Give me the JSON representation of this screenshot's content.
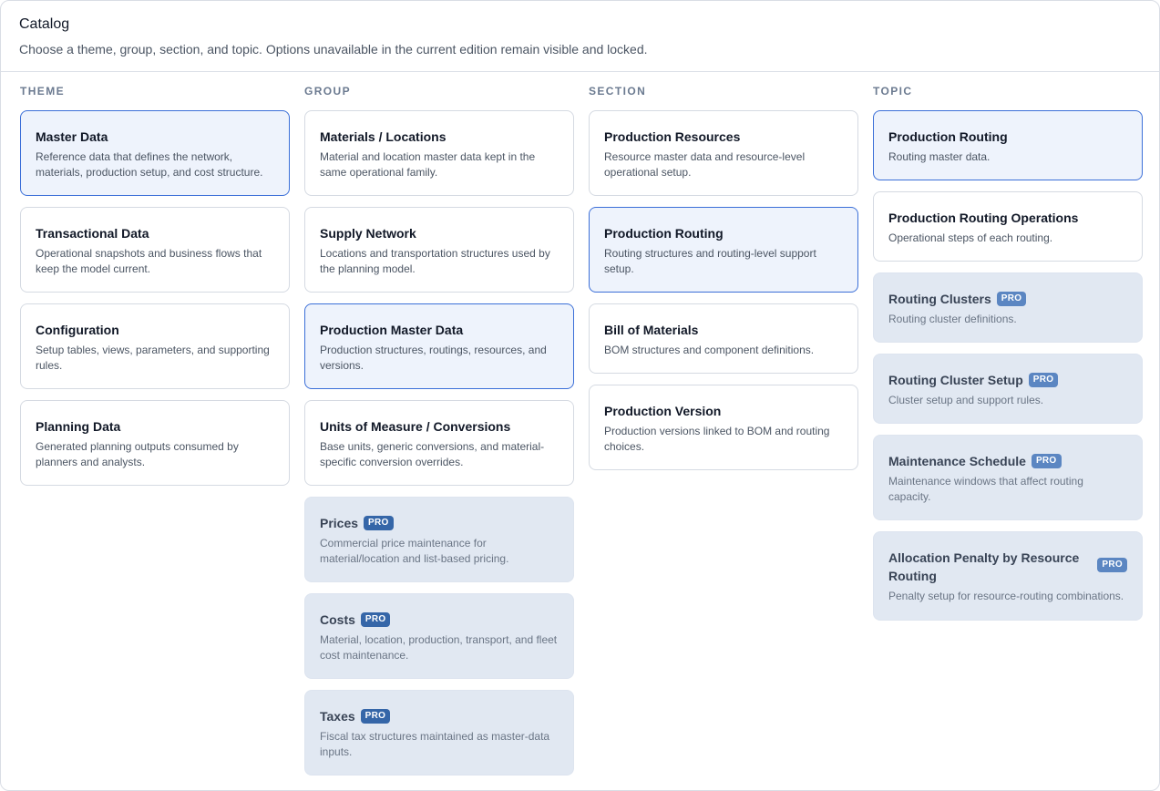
{
  "header": {
    "title": "Catalog",
    "subtitle": "Choose a theme, group, section, and topic. Options unavailable in the current edition remain visible and locked."
  },
  "badge_label": "PRO",
  "columns": {
    "theme": {
      "heading": "THEME",
      "cards": [
        {
          "title": "Master Data",
          "desc": "Reference data that defines the network, materials, production setup, and cost structure."
        },
        {
          "title": "Transactional Data",
          "desc": "Operational snapshots and business flows that keep the model current."
        },
        {
          "title": "Configuration",
          "desc": "Setup tables, views, parameters, and supporting rules."
        },
        {
          "title": "Planning Data",
          "desc": "Generated planning outputs consumed by planners and analysts."
        }
      ]
    },
    "group": {
      "heading": "GROUP",
      "cards": [
        {
          "title": "Materials / Locations",
          "desc": "Material and location master data kept in the same operational family."
        },
        {
          "title": "Supply Network",
          "desc": "Locations and transportation structures used by the planning model."
        },
        {
          "title": "Production Master Data",
          "desc": "Production structures, routings, resources, and versions."
        },
        {
          "title": "Units of Measure / Conversions",
          "desc": "Base units, generic conversions, and material-specific conversion overrides."
        },
        {
          "title": "Prices",
          "desc": "Commercial price maintenance for material/location and list-based pricing."
        },
        {
          "title": "Costs",
          "desc": "Material, location, production, transport, and fleet cost maintenance."
        },
        {
          "title": "Taxes",
          "desc": "Fiscal tax structures maintained as master-data inputs."
        }
      ]
    },
    "section": {
      "heading": "SECTION",
      "cards": [
        {
          "title": "Production Resources",
          "desc": "Resource master data and resource-level operational setup."
        },
        {
          "title": "Production Routing",
          "desc": "Routing structures and routing-level support setup."
        },
        {
          "title": "Bill of Materials",
          "desc": "BOM structures and component definitions."
        },
        {
          "title": "Production Version",
          "desc": "Production versions linked to BOM and routing choices."
        }
      ]
    },
    "topic": {
      "heading": "TOPIC",
      "cards": [
        {
          "title": "Production Routing",
          "desc": "Routing master data."
        },
        {
          "title": "Production Routing Operations",
          "desc": "Operational steps of each routing."
        },
        {
          "title": "Routing Clusters",
          "desc": "Routing cluster definitions."
        },
        {
          "title": "Routing Cluster Setup",
          "desc": "Cluster setup and support rules."
        },
        {
          "title": "Maintenance Schedule",
          "desc": "Maintenance windows that affect routing capacity."
        },
        {
          "title": "Allocation Penalty by Resource Routing",
          "desc": "Penalty setup for resource-routing combinations."
        }
      ]
    }
  },
  "colors": {
    "selected_border": "#3b6fd8",
    "selected_bg": "#eef3fc",
    "locked_bg": "#e1e8f2",
    "pro_badge": "#3566a8"
  }
}
